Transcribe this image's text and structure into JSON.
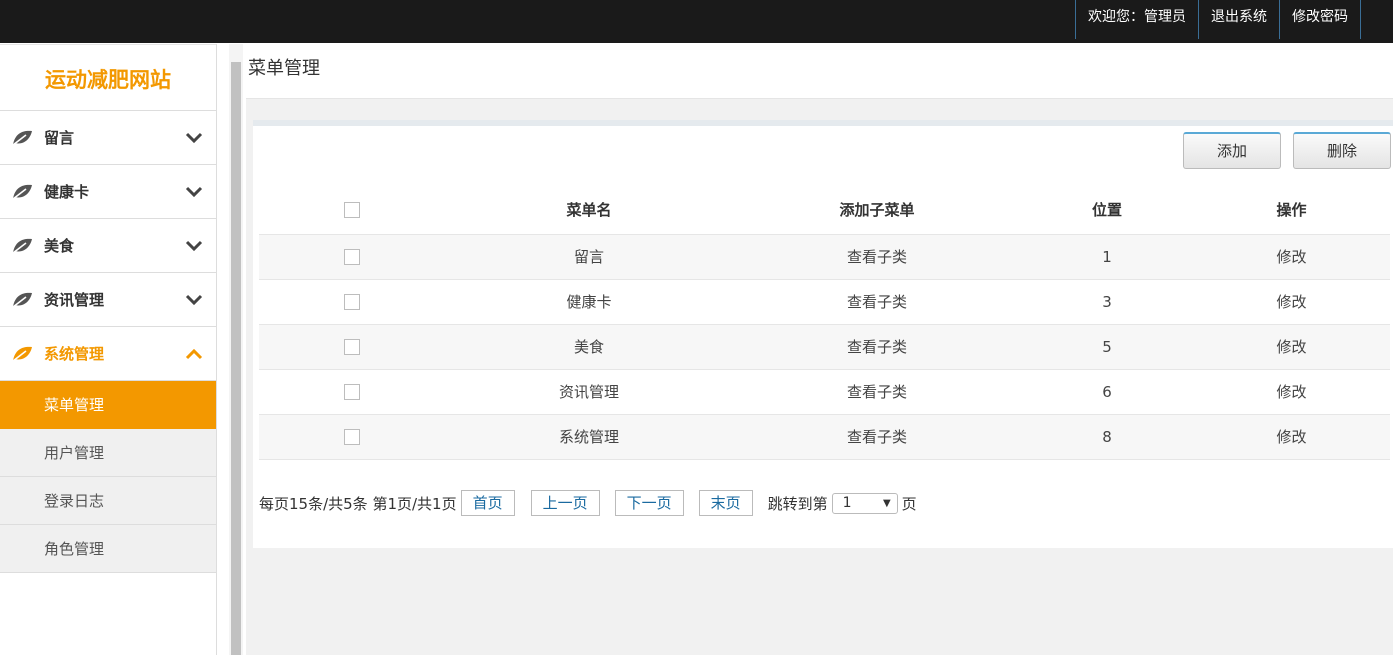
{
  "topbar": {
    "welcome": "欢迎您：管理员",
    "logout": "退出系统",
    "change_password": "修改密码"
  },
  "sidebar": {
    "logo": "运动减肥网站",
    "menus": [
      {
        "label": "留言",
        "icon": "leaf-icon",
        "expanded": false
      },
      {
        "label": "健康卡",
        "icon": "leaf-icon",
        "expanded": false
      },
      {
        "label": "美食",
        "icon": "leaf-icon",
        "expanded": false
      },
      {
        "label": "资讯管理",
        "icon": "leaf-icon",
        "expanded": false
      },
      {
        "label": "系统管理",
        "icon": "leaf-icon",
        "expanded": true
      }
    ],
    "submenu": [
      {
        "label": "菜单管理",
        "active": true
      },
      {
        "label": "用户管理",
        "active": false
      },
      {
        "label": "登录日志",
        "active": false
      },
      {
        "label": "角色管理",
        "active": false
      }
    ]
  },
  "main": {
    "title": "菜单管理",
    "buttons": {
      "add": "添加",
      "delete": "删除"
    },
    "table": {
      "headers": [
        "菜单名",
        "添加子菜单",
        "位置",
        "操作"
      ],
      "rows": [
        {
          "name": "留言",
          "sub": "查看子类",
          "position": "1",
          "action": "修改"
        },
        {
          "name": "健康卡",
          "sub": "查看子类",
          "position": "3",
          "action": "修改"
        },
        {
          "name": "美食",
          "sub": "查看子类",
          "position": "5",
          "action": "修改"
        },
        {
          "name": "资讯管理",
          "sub": "查看子类",
          "position": "6",
          "action": "修改"
        },
        {
          "name": "系统管理",
          "sub": "查看子类",
          "position": "8",
          "action": "修改"
        }
      ]
    },
    "pager": {
      "summary": "每页15条/共5条 第1页/共1页",
      "first": "首页",
      "prev": "上一页",
      "next": "下一页",
      "last": "末页",
      "jump_label": "跳转到第",
      "jump_value": "1",
      "jump_suffix": "页"
    }
  },
  "colors": {
    "accent": "#f39800",
    "topbar": "#1a1a1a",
    "link": "#1a6aa0"
  }
}
